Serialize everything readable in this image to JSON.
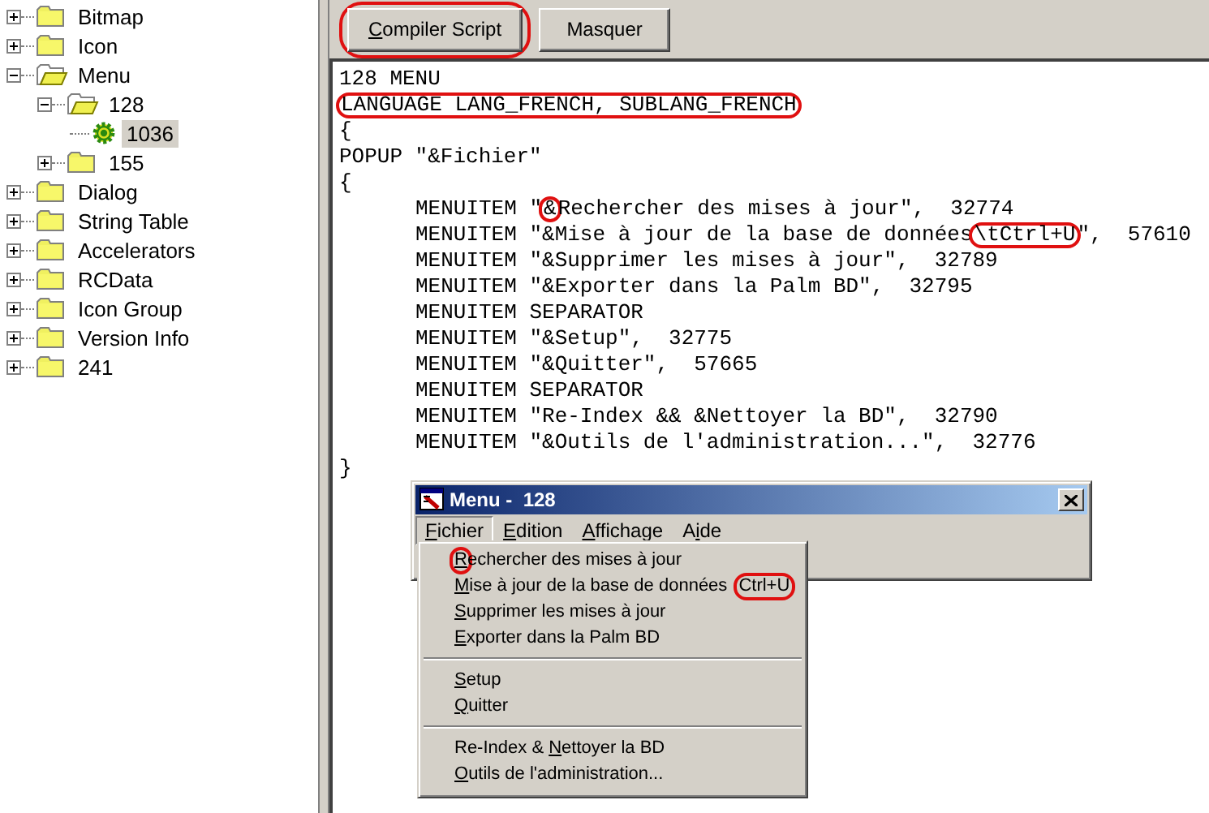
{
  "tree": [
    {
      "label": "Bitmap",
      "kind": "folder",
      "expanded": false,
      "selected": false
    },
    {
      "label": "Icon",
      "kind": "folder",
      "expanded": false,
      "selected": false
    },
    {
      "label": "Menu",
      "kind": "folder",
      "expanded": true,
      "selected": false,
      "children": [
        {
          "label": "128",
          "kind": "folder",
          "expanded": true,
          "selected": false,
          "children": [
            {
              "label": "1036",
              "kind": "gear",
              "selected": true
            }
          ]
        },
        {
          "label": "155",
          "kind": "folder",
          "expanded": false,
          "selected": false
        }
      ]
    },
    {
      "label": "Dialog",
      "kind": "folder",
      "expanded": false,
      "selected": false
    },
    {
      "label": "String Table",
      "kind": "folder",
      "expanded": false,
      "selected": false
    },
    {
      "label": "Accelerators",
      "kind": "folder",
      "expanded": false,
      "selected": false
    },
    {
      "label": "RCData",
      "kind": "folder",
      "expanded": false,
      "selected": false
    },
    {
      "label": "Icon Group",
      "kind": "folder",
      "expanded": false,
      "selected": false
    },
    {
      "label": "Version Info",
      "kind": "folder",
      "expanded": false,
      "selected": false
    },
    {
      "label": "241",
      "kind": "folder",
      "expanded": false,
      "selected": false
    }
  ],
  "toolbar": {
    "buttons": [
      {
        "key": "C",
        "after": "ompiler Script",
        "circled": true
      },
      {
        "after": "Masquer",
        "circled": false
      }
    ]
  },
  "code": [
    {
      "indent": false,
      "segments": [
        {
          "text": "128 MENU",
          "circled": false
        }
      ]
    },
    {
      "indent": false,
      "segments": [
        {
          "text": "LANGUAGE LANG_FRENCH, SUBLANG_FRENCH",
          "circled": true
        }
      ]
    },
    {
      "indent": false,
      "segments": [
        {
          "text": "{",
          "circled": false
        }
      ]
    },
    {
      "indent": false,
      "segments": [
        {
          "text": "POPUP \"&Fichier\"",
          "circled": false
        }
      ]
    },
    {
      "indent": false,
      "segments": [
        {
          "text": "{",
          "circled": false
        }
      ]
    },
    {
      "indent": true,
      "segments": [
        {
          "text": "MENUITEM \"",
          "circled": false
        },
        {
          "text": "&",
          "circled": true
        },
        {
          "text": "Rechercher des mises à jour\",  32774",
          "circled": false
        }
      ]
    },
    {
      "indent": true,
      "segments": [
        {
          "text": "MENUITEM \"&Mise à jour de la base de données",
          "circled": false
        },
        {
          "text": "\\tCtrl+U",
          "circled": true
        },
        {
          "text": "\",  57610",
          "circled": false
        }
      ]
    },
    {
      "indent": true,
      "segments": [
        {
          "text": "MENUITEM \"&Supprimer les mises à jour\",  32789",
          "circled": false
        }
      ]
    },
    {
      "indent": true,
      "segments": [
        {
          "text": "MENUITEM \"&Exporter dans la Palm BD\",  32795",
          "circled": false
        }
      ]
    },
    {
      "indent": true,
      "segments": [
        {
          "text": "MENUITEM SEPARATOR",
          "circled": false
        }
      ]
    },
    {
      "indent": true,
      "segments": [
        {
          "text": "MENUITEM \"&Setup\",  32775",
          "circled": false
        }
      ]
    },
    {
      "indent": true,
      "segments": [
        {
          "text": "MENUITEM \"&Quitter\",  57665",
          "circled": false
        }
      ]
    },
    {
      "indent": true,
      "segments": [
        {
          "text": "MENUITEM SEPARATOR",
          "circled": false
        }
      ]
    },
    {
      "indent": true,
      "segments": [
        {
          "text": "MENUITEM \"Re-Index && &Nettoyer la BD\",  32790",
          "circled": false
        }
      ]
    },
    {
      "indent": true,
      "segments": [
        {
          "text": "MENUITEM \"&Outils de l'administration...\",  32776",
          "circled": false
        }
      ]
    },
    {
      "indent": false,
      "segments": [
        {
          "text": "}",
          "circled": false
        }
      ]
    }
  ],
  "menu_window": {
    "title": "Menu -  128",
    "menubar": [
      {
        "key": "F",
        "after": "ichier",
        "selected": true
      },
      {
        "key": "E",
        "after": "dition",
        "selected": false
      },
      {
        "key": "A",
        "after": "ffichage",
        "selected": false
      },
      {
        "before": "A",
        "key": "i",
        "after": "de",
        "selected": false
      }
    ],
    "dropdown": [
      {
        "kind": "item",
        "key": "R",
        "after": "echercher des mises à jour",
        "key_circled": true
      },
      {
        "kind": "item",
        "key": "M",
        "after": "ise à jour de la base de données",
        "shortcut": "Ctrl+U",
        "shortcut_circled": true,
        "key_circled": false
      },
      {
        "kind": "item",
        "key": "S",
        "after": "upprimer les mises à jour",
        "key_circled": false
      },
      {
        "kind": "item",
        "key": "E",
        "after": "xporter dans la Palm BD",
        "key_circled": false
      },
      {
        "kind": "separator"
      },
      {
        "kind": "item",
        "key": "S",
        "after": "etup",
        "key_circled": false
      },
      {
        "kind": "item",
        "key": "Q",
        "after": "uitter",
        "key_circled": false
      },
      {
        "kind": "separator"
      },
      {
        "kind": "item",
        "before": "Re-Index & ",
        "key": "N",
        "after": "ettoyer la BD",
        "key_circled": false
      },
      {
        "kind": "item",
        "key": "O",
        "after": "utils de l'administration...",
        "key_circled": false
      }
    ]
  }
}
